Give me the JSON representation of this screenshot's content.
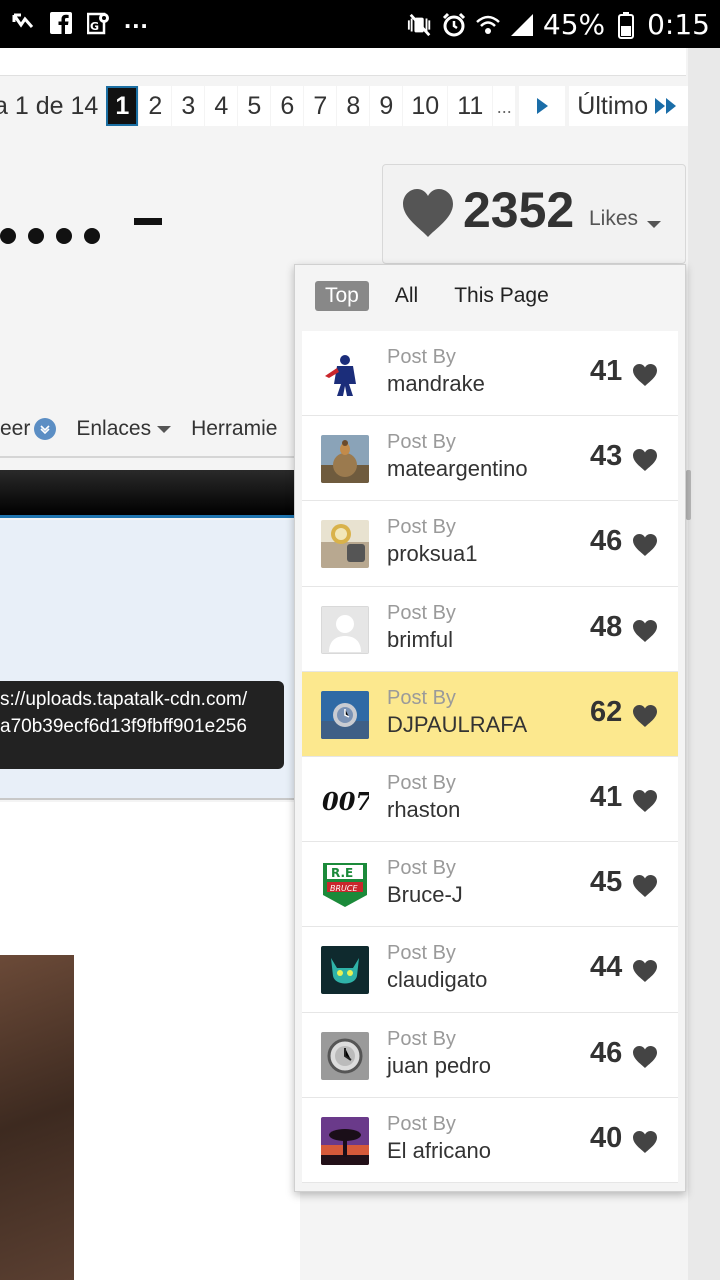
{
  "status_bar": {
    "battery": "45%",
    "time": "0:15",
    "more": "..."
  },
  "pagination": {
    "label": "a 1 de 14",
    "pages": [
      "1",
      "2",
      "3",
      "4",
      "5",
      "6",
      "7",
      "8",
      "9",
      "10",
      "11"
    ],
    "current": "1",
    "ellipsis": "...",
    "last_label": "Último"
  },
  "nav": {
    "item1": "eer",
    "item2": "Enlaces",
    "item3": "Herramie"
  },
  "tooltip": {
    "line1": "s://uploads.tapatalk-cdn.com/",
    "line2": "a70b39ecf6d13f9fbff901e256"
  },
  "likes": {
    "count": "2352",
    "label": "Likes"
  },
  "dropdown": {
    "tabs": [
      "Top",
      "All",
      "This Page"
    ],
    "active_tab": "Top",
    "prefix": "Post By",
    "rows": [
      {
        "user": "mandrake",
        "count": "41",
        "avatar": "superhero-avatar"
      },
      {
        "user": "mateargentino",
        "count": "43",
        "avatar": "bird-avatar"
      },
      {
        "user": "proksua1",
        "count": "46",
        "avatar": "watch-avatar"
      },
      {
        "user": "brimful",
        "count": "48",
        "avatar": "default-avatar"
      },
      {
        "user": "DJPAULRAFA",
        "count": "62",
        "avatar": "watch-wrist-avatar",
        "highlight": true
      },
      {
        "user": "rhaston",
        "count": "41",
        "avatar": "007-logo-avatar"
      },
      {
        "user": "Bruce-J",
        "count": "45",
        "avatar": "badge-avatar"
      },
      {
        "user": "claudigato",
        "count": "44",
        "avatar": "cat-avatar"
      },
      {
        "user": "juan pedro",
        "count": "46",
        "avatar": "watch-dial-avatar"
      },
      {
        "user": "El africano",
        "count": "40",
        "avatar": "tree-sunset-avatar"
      }
    ]
  },
  "colors": {
    "highlight": "#fce88e",
    "active_page_bg": "#111111",
    "active_tab_bg": "#888888",
    "heart": "#444444"
  }
}
